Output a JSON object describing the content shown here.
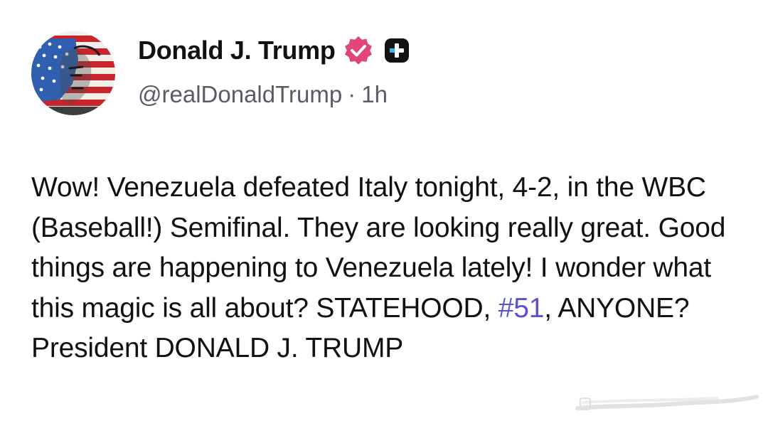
{
  "post": {
    "author": {
      "display_name": "Donald J. Trump",
      "handle": "@realDonaldTrump",
      "separator": "·",
      "time_ago": "1h",
      "verified_icon": "verified-badge-icon",
      "verified_color": "#e0457b",
      "plus_icon": "plus-badge-icon"
    },
    "body": {
      "text_before_hashtag": "Wow! Venezuela defeated Italy tonight, 4-2, in the WBC (Baseball!) Semifinal. They are looking really great. Good things are happening to Venezuela lately! I wonder what this magic is all about? STATEHOOD, ",
      "hashtag": "#51",
      "text_after_hashtag": ", ANYONE? President DONALD J. TRUMP"
    }
  },
  "colors": {
    "text": "#111111",
    "muted": "#5b5b66",
    "hashtag": "#5b4fd6",
    "background": "#ffffff"
  }
}
